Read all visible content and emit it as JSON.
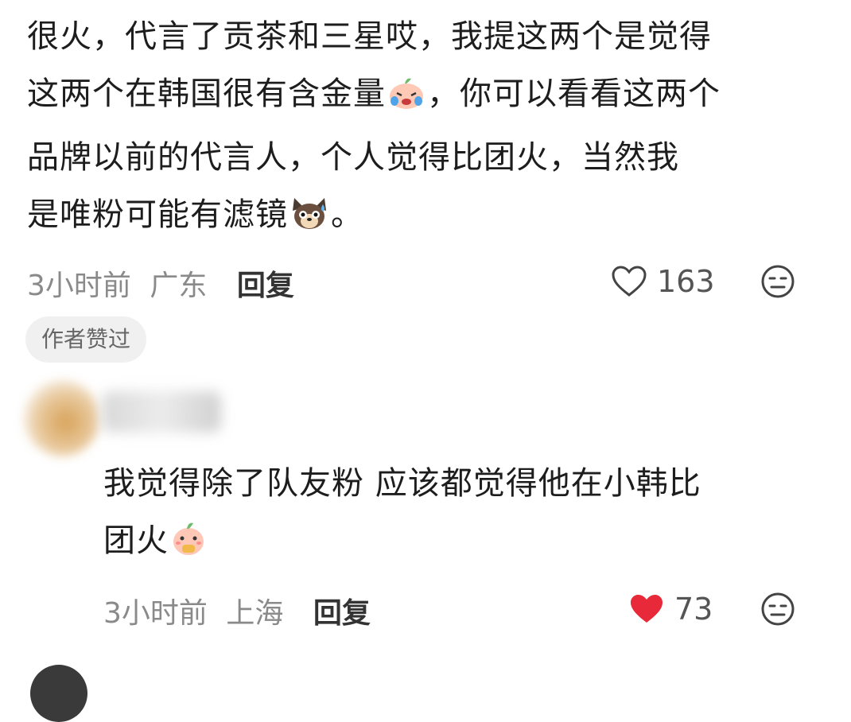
{
  "comments": [
    {
      "lines": [
        "很火，代言了贡茶和三星哎，我提这两个是觉得",
        "这两个在韩国很有含金量",
        "，你可以看看这两个",
        "品牌以前的代言人，个人觉得比团火，当然我",
        "是唯粉可能有滤镜",
        "。"
      ],
      "time": "3小时前",
      "location": "广东",
      "reply_label": "回复",
      "likes": "163",
      "liked": false,
      "badge": "作者赞过"
    },
    {
      "lines": [
        "我觉得除了队友粉 应该都觉得他在小韩比",
        "团火"
      ],
      "time": "3小时前",
      "location": "上海",
      "reply_label": "回复",
      "likes": "73",
      "liked": true
    }
  ],
  "icons": {
    "like_outline": "heart-outline-icon",
    "like_filled": "heart-filled-icon",
    "dislike": "meh-face-icon",
    "emoji_cry": "crying-peach-emoji",
    "emoji_dog": "sweating-dog-emoji",
    "emoji_eat": "eating-peach-emoji"
  },
  "colors": {
    "like_red": "#e8293a",
    "meta_gray": "#8a8a8a",
    "badge_bg": "#f0f0f0"
  }
}
